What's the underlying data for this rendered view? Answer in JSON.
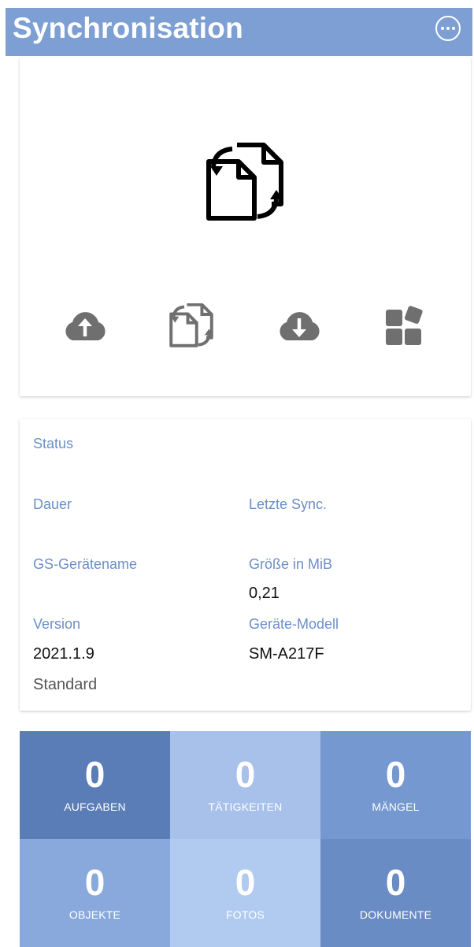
{
  "header": {
    "title": "Synchronisation",
    "more_icon": "more-horizontal-circle-icon",
    "color": "#7d9fd3"
  },
  "actions": [
    {
      "icon": "cloud-upload-icon"
    },
    {
      "icon": "file-sync-icon"
    },
    {
      "icon": "cloud-download-icon"
    },
    {
      "icon": "apps-icon"
    }
  ],
  "info": {
    "status_label": "Status",
    "dauer_label": "Dauer",
    "letzte_sync_label": "Letzte Sync.",
    "geraetename_label": "GS-Gerätename",
    "groesse_label": "Größe in MiB",
    "groesse_value": "0,21",
    "version_label": "Version",
    "version_value": "2021.1.9",
    "modell_label": "Geräte-Modell",
    "modell_value": "SM-A217F",
    "edition_value": "Standard"
  },
  "tiles": [
    {
      "count": "0",
      "label": "AUFGABEN",
      "color": "#5b7db7"
    },
    {
      "count": "0",
      "label": "TÄTIGKEITEN",
      "color": "#a7c1ea"
    },
    {
      "count": "0",
      "label": "MÄNGEL",
      "color": "#7598d0"
    },
    {
      "count": "0",
      "label": "OBJEKTE",
      "color": "#89a9dd"
    },
    {
      "count": "0",
      "label": "FOTOS",
      "color": "#b1cbf0"
    },
    {
      "count": "0",
      "label": "DOKUMENTE",
      "color": "#6a8cc4"
    }
  ]
}
